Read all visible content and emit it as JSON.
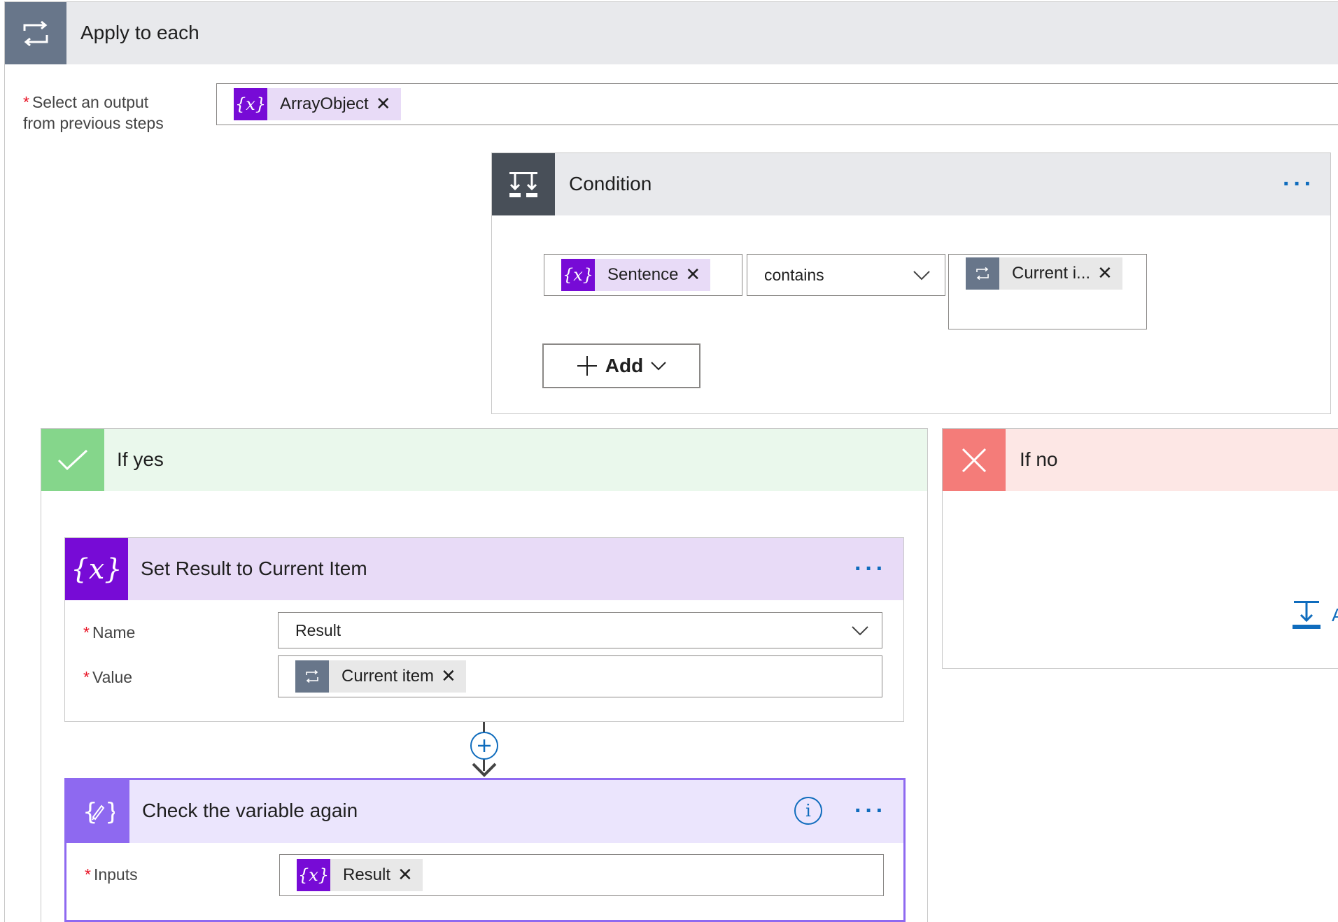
{
  "apply_to_each": {
    "title": "Apply to each",
    "field_label_line1": "Select an output",
    "field_label_line2": "from previous steps",
    "token": "ArrayObject"
  },
  "condition": {
    "title": "Condition",
    "left_token": "Sentence",
    "operator": "contains",
    "right_token": "Current i...",
    "add_label": "Add"
  },
  "if_yes": {
    "title": "If yes"
  },
  "if_no": {
    "title": "If no",
    "add_action_partial": "A"
  },
  "set_variable": {
    "title": "Set Result to Current Item",
    "name_label": "Name",
    "name_value": "Result",
    "value_label": "Value",
    "value_token": "Current item"
  },
  "compose": {
    "title": "Check the variable again",
    "inputs_label": "Inputs",
    "inputs_token": "Result"
  },
  "symbols": {
    "required": "*",
    "remove": "✕",
    "more": "···",
    "variable": "{x}",
    "info": "i",
    "plus": "+"
  },
  "colors": {
    "variable_purple": "#770bd6",
    "variable_token_bg": "#e8dbf7",
    "loop_gray": "#68768a",
    "condition_dark": "#484f58",
    "yes_green": "#85d68b",
    "no_red": "#f47c79",
    "compose_violet": "#8e69f0",
    "link_blue": "#0f6cbd"
  }
}
